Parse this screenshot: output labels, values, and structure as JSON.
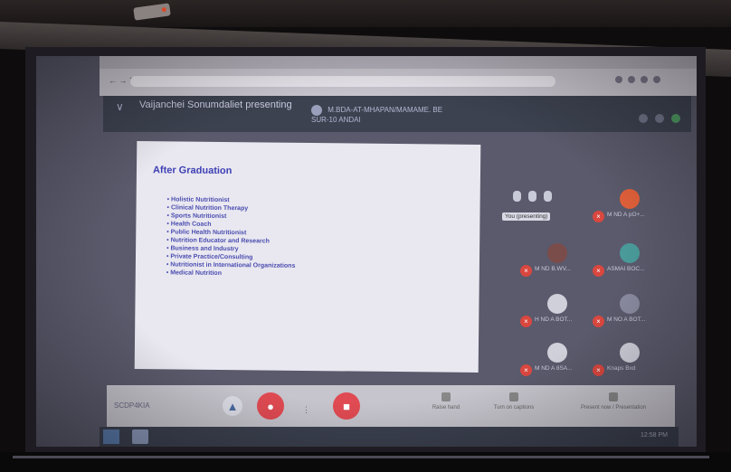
{
  "meet": {
    "presenter": "Vaijanchei Sonumdaliet presenting",
    "pinned_text": "M.BDA-AT-MHAPAN/MAMAME. BE SUR-10 ANDAI",
    "you_label": "You (presenting)"
  },
  "slide": {
    "title": "After Graduation",
    "items": [
      "Holistic Nutritionist",
      "Clinical Nutrition Therapy",
      "Sports Nutritionist",
      "Health Coach",
      "Public Health Nutritionist",
      "Nutrition Educator and Research",
      "Business and Industry",
      "Private Practice/Consulting",
      "Nutritionist in International Organizations",
      "Medical Nutrition"
    ]
  },
  "participants": [
    {
      "name": "M ND A pO+..."
    },
    {
      "name": "M ND B.WV..."
    },
    {
      "name": "ASMAI BOC..."
    },
    {
      "name": "H ND A BOT..."
    },
    {
      "name": "M NO A BOT..."
    },
    {
      "name": "M ND A 8SA..."
    },
    {
      "name": "Knaps Bxd"
    }
  ],
  "bottom": {
    "meeting_code": "SCDP4KIA",
    "dots": "⋮",
    "actions": [
      "Raise hand",
      "Turn on captions",
      "Present now / Presentation"
    ]
  },
  "taskbar": {
    "clock": "12:58 PM"
  },
  "colors": {
    "end_call": "#e04a52",
    "slide_text": "#4a4cb0",
    "mic_off": "#d9473f"
  }
}
